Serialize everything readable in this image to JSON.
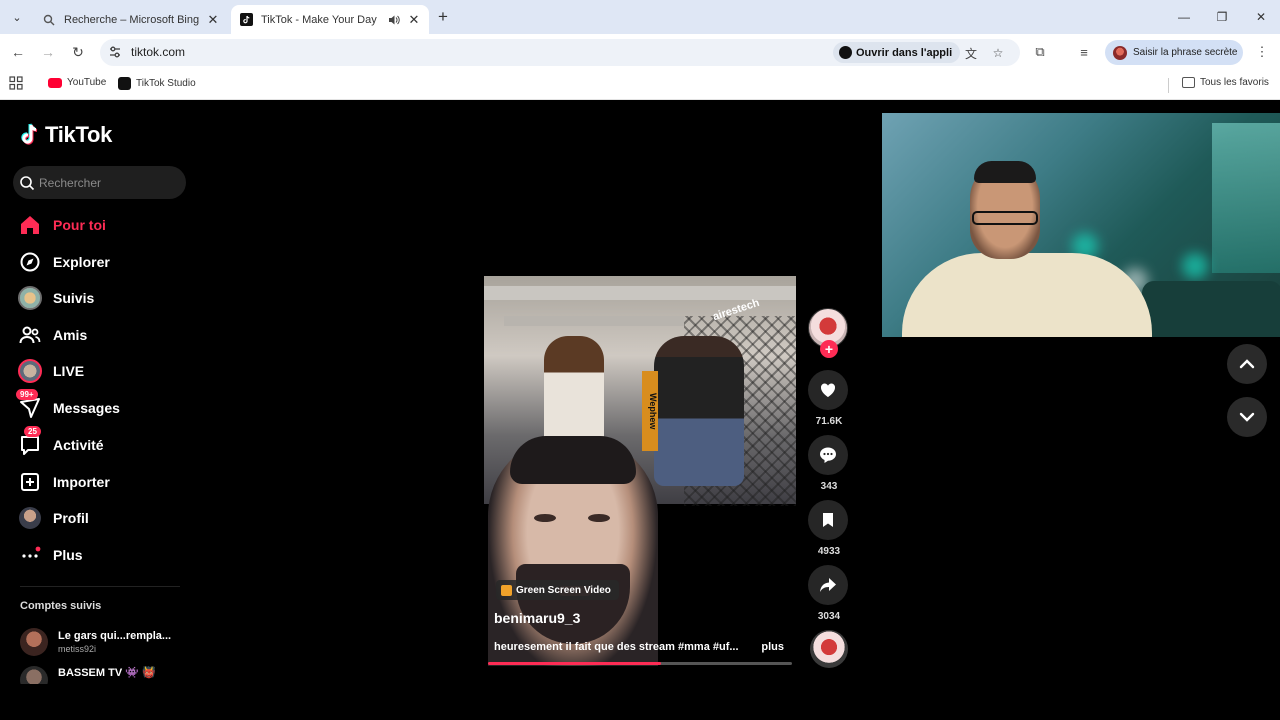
{
  "browser": {
    "tabs": [
      {
        "title": "Recherche – Microsoft Bing",
        "icon": "search-icon",
        "active": false
      },
      {
        "title": "TikTok - Make Your Day",
        "icon": "tiktok-icon",
        "active": true
      }
    ],
    "url": "tiktok.com",
    "open_in_app_label": "Ouvrir dans l'appli",
    "passkey_label": "Saisir la phrase secrète",
    "bookmarks": [
      {
        "label": "YouTube",
        "icon": "youtube-icon"
      },
      {
        "label": "TikTok Studio",
        "icon": "tiktok-icon"
      }
    ],
    "all_favorites_label": "Tous les favoris"
  },
  "sidebar": {
    "logo_text": "TikTok",
    "search_placeholder": "Rechercher",
    "nav": [
      {
        "label": "Pour toi",
        "icon": "home-icon",
        "active": true
      },
      {
        "label": "Explorer",
        "icon": "compass-icon"
      },
      {
        "label": "Suivis",
        "icon": "following-avatar-icon"
      },
      {
        "label": "Amis",
        "icon": "friends-icon"
      },
      {
        "label": "LIVE",
        "icon": "live-icon"
      },
      {
        "label": "Messages",
        "icon": "messages-icon",
        "badge": "99+"
      },
      {
        "label": "Activité",
        "icon": "inbox-icon",
        "badge": "25"
      },
      {
        "label": "Importer",
        "icon": "upload-icon"
      },
      {
        "label": "Profil",
        "icon": "profile-avatar-icon"
      },
      {
        "label": "Plus",
        "icon": "more-icon"
      }
    ],
    "following_title": "Comptes suivis",
    "accounts": [
      {
        "name": "Le gars qui...rempla...",
        "handle": "metiss92i"
      },
      {
        "name": "BASSEM TV 👾 👹",
        "handle": ""
      }
    ]
  },
  "video": {
    "effect_label": "Green Screen Video",
    "author": "benimaru9_3",
    "caption": "heuresement il fait que des stream #mma #uf...",
    "more_label": "plus",
    "progress": 0.57,
    "scene_sign": "airestech",
    "scene_banner": "Wephew"
  },
  "actions": {
    "likes": "71.6K",
    "comments": "343",
    "saves": "4933",
    "shares": "3034"
  },
  "colors": {
    "accent": "#fe2c55",
    "tab_bar": "#dfe7f5"
  }
}
